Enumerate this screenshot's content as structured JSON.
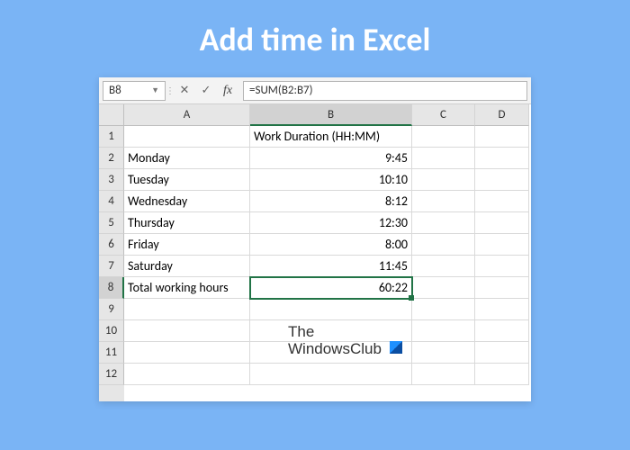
{
  "page": {
    "title": "Add time in Excel"
  },
  "formula_bar": {
    "cell_ref": "B8",
    "formula": "=SUM(B2:B7)"
  },
  "columns": [
    "A",
    "B",
    "C",
    "D"
  ],
  "row_numbers": [
    "1",
    "2",
    "3",
    "4",
    "5",
    "6",
    "7",
    "8",
    "9",
    "10",
    "11",
    "12"
  ],
  "selected": {
    "row": "8",
    "col": "B"
  },
  "cells": {
    "B1": "Work Duration (HH:MM)",
    "A2": "Monday",
    "B2": "9:45",
    "A3": "Tuesday",
    "B3": "10:10",
    "A4": "Wednesday",
    "B4": "8:12",
    "A5": "Thursday",
    "B5": "12:30",
    "A6": "Friday",
    "B6": "8:00",
    "A7": "Saturday",
    "B7": "11:45",
    "A8": "Total working hours",
    "B8": "60:22"
  },
  "watermark": {
    "line1": "The",
    "line2": "WindowsClub"
  }
}
